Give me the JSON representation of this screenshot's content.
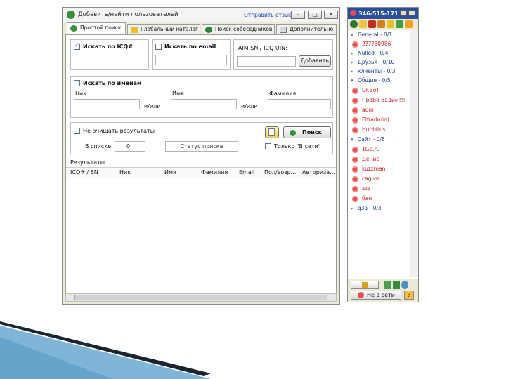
{
  "window": {
    "title": "Добавить/найти пользователей",
    "send_link": "Отправить отзыв"
  },
  "tabs": [
    "Простой поиск",
    "Глобальный каталог",
    "Поиск собеседников",
    "Дополнительно"
  ],
  "search": {
    "by_icq_label": "Искать по ICQ#",
    "by_email_label": "Искать по email",
    "aim_label": "AIM SN / ICQ UIN:",
    "add_button": "Добавить",
    "by_names_label": "Искать по именам",
    "nick_label": "Ник",
    "name_label": "Имя",
    "surname_label": "Фамилия",
    "or1": "и/или",
    "or2": "и/или",
    "keep_results_label": "Не очищать результаты",
    "in_list_label": "В списке:",
    "in_list_value": "0",
    "status_text": "Статус поиска",
    "search_button": "Поиск",
    "online_only_label": "Только \"В сети\""
  },
  "results": {
    "title": "Результаты",
    "columns": [
      "ICQ# / SN",
      "Ник",
      "Имя",
      "Фамилия",
      "Email",
      "Пол/возр...",
      "Авториза..."
    ]
  },
  "contact_list": {
    "uin": "346-515-171",
    "groups": [
      {
        "name": "General - 0/1",
        "expanded": true,
        "contacts": [
          "2?7?80986"
        ]
      },
      {
        "name": "Nulled - 0/4",
        "expanded": false,
        "contacts": []
      },
      {
        "name": "Друзья - 0/10",
        "expanded": false,
        "contacts": []
      },
      {
        "name": "клиенты - 0/3",
        "expanded": false,
        "contacts": []
      },
      {
        "name": "Общие - 0/5",
        "expanded": true,
        "contacts": [
          "Dr.BoT",
          "ПроВо Вадим!!!",
          "adm",
          "Elf(admin)",
          "Hubbitus"
        ]
      },
      {
        "name": "Сайт - 0/6",
        "expanded": true,
        "contacts": [
          "1Gb.ru",
          "Денис",
          "kuzzman",
          "cagive",
          "zzz",
          "бан"
        ]
      },
      {
        "name": "q3a - 0/3",
        "expanded": false,
        "contacts": []
      }
    ],
    "status_button": "Не в сети"
  },
  "colors": {
    "header_blue": "#2a4f9f",
    "contact_red": "#c52020",
    "group_blue": "#1f3f8f",
    "deco_dark": "#1a2530",
    "deco_light": "#7fb5d6"
  }
}
